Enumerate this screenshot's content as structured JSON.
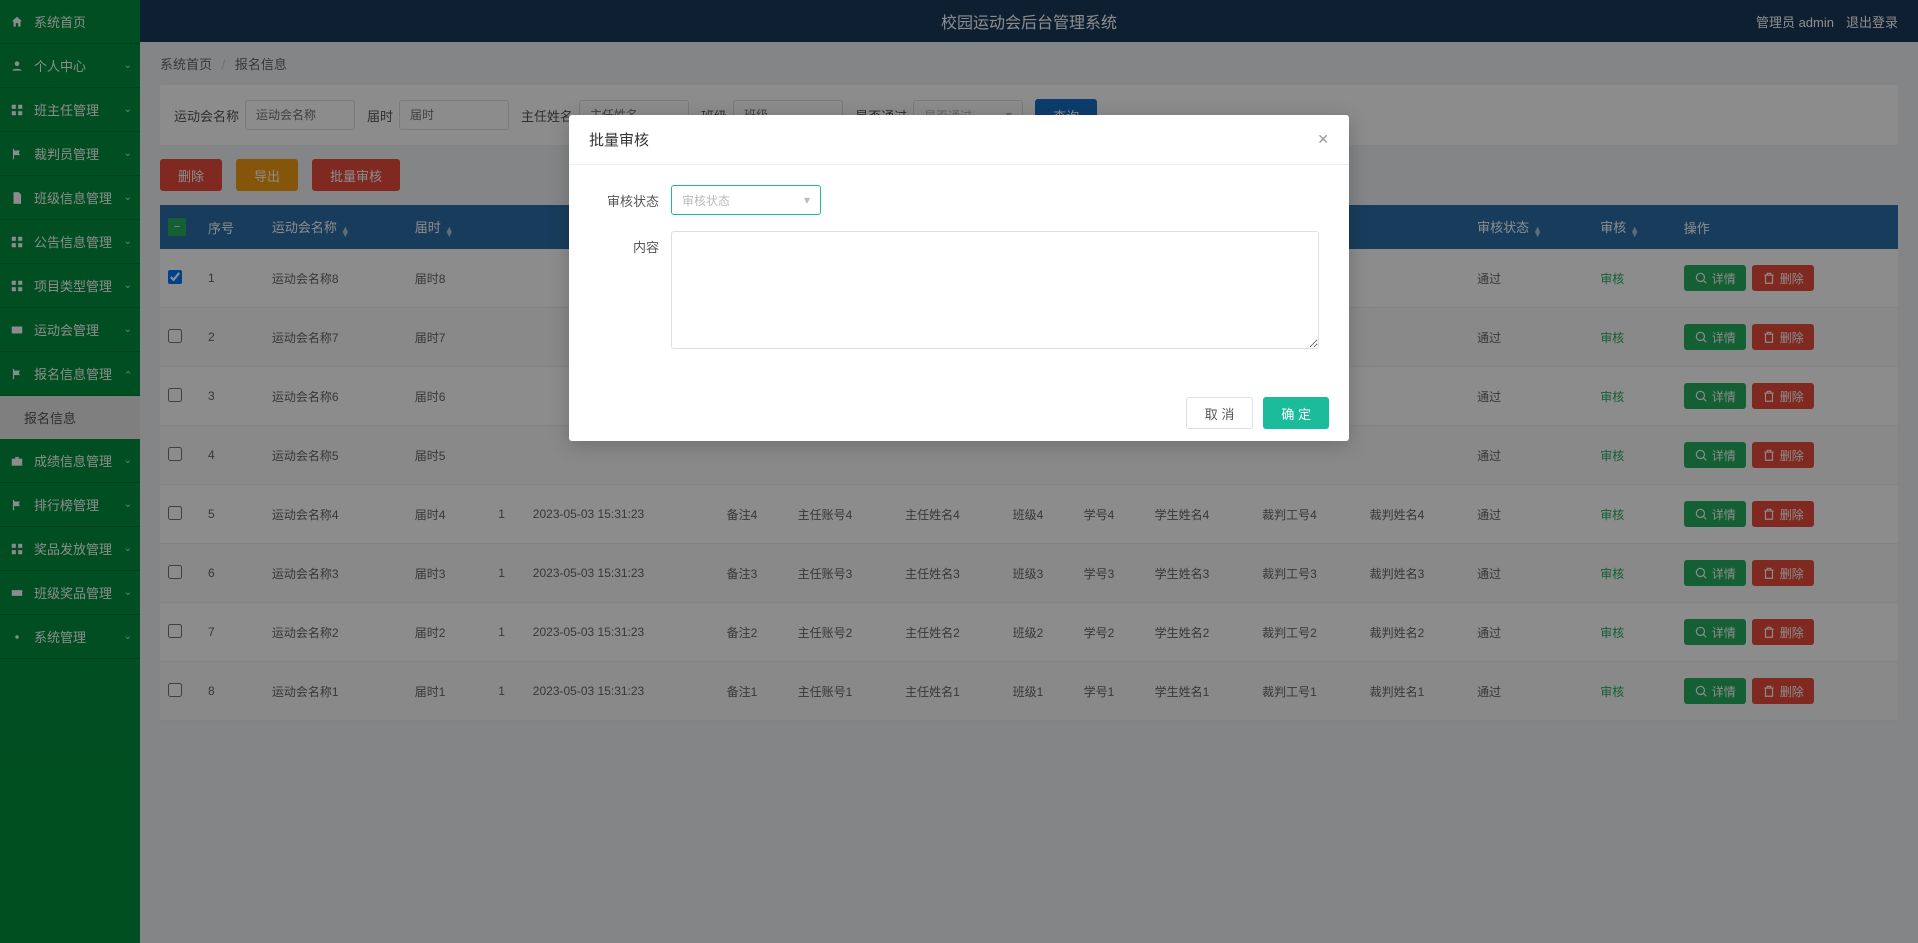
{
  "header": {
    "title": "校园运动会后台管理系统",
    "admin_label": "管理员 admin",
    "logout": "退出登录"
  },
  "sidebar": {
    "items": [
      {
        "label": "系统首页",
        "icon": "home"
      },
      {
        "label": "个人中心",
        "icon": "user"
      },
      {
        "label": "班主任管理",
        "icon": "grid"
      },
      {
        "label": "裁判员管理",
        "icon": "flag"
      },
      {
        "label": "班级信息管理",
        "icon": "file"
      },
      {
        "label": "公告信息管理",
        "icon": "grid"
      },
      {
        "label": "项目类型管理",
        "icon": "grid"
      },
      {
        "label": "运动会管理",
        "icon": "card"
      },
      {
        "label": "报名信息管理",
        "icon": "flag",
        "expanded": true,
        "sub": "报名信息"
      },
      {
        "label": "成绩信息管理",
        "icon": "case"
      },
      {
        "label": "排行榜管理",
        "icon": "flag"
      },
      {
        "label": "奖品发放管理",
        "icon": "grid"
      },
      {
        "label": "班级奖品管理",
        "icon": "ticket"
      },
      {
        "label": "系统管理",
        "icon": "gear"
      }
    ]
  },
  "breadcrumb": {
    "home": "系统首页",
    "current": "报名信息"
  },
  "filters": {
    "name_label": "运动会名称",
    "name_ph": "运动会名称",
    "time_label": "届时",
    "time_ph": "届时",
    "teacher_label": "主任姓名",
    "teacher_ph": "主任姓名",
    "class_label": "班级",
    "class_ph": "班级",
    "pass_label": "是否通过",
    "pass_ph": "是否通过",
    "query_btn": "查询"
  },
  "actions": {
    "delete": "删除",
    "export": "导出",
    "batch": "批量审核"
  },
  "table": {
    "headers": [
      "",
      "序号",
      "运动会名称",
      "届时",
      "",
      "",
      "",
      "",
      "",
      "",
      "",
      "",
      "",
      "",
      "审核状态",
      "审核",
      "操作"
    ],
    "rows": [
      {
        "checked": true,
        "idx": "1",
        "name": "运动会名称8",
        "time": "届时8",
        "status": "通过",
        "review": "审核"
      },
      {
        "checked": false,
        "idx": "2",
        "name": "运动会名称7",
        "time": "届时7",
        "status": "通过",
        "review": "审核"
      },
      {
        "checked": false,
        "idx": "3",
        "name": "运动会名称6",
        "time": "届时6",
        "status": "通过",
        "review": "审核"
      },
      {
        "checked": false,
        "idx": "4",
        "name": "运动会名称5",
        "time": "届时5",
        "status": "通过",
        "review": "审核"
      },
      {
        "checked": false,
        "idx": "5",
        "name": "运动会名称4",
        "time": "届时4",
        "num": "1",
        "date": "2023-05-03 15:31:23",
        "remark": "备注4",
        "acct": "主任账号4",
        "tname": "主任姓名4",
        "class": "班级4",
        "sid": "学号4",
        "sname": "学生姓名4",
        "jid": "裁判工号4",
        "jname": "裁判姓名4",
        "status": "通过",
        "review": "审核"
      },
      {
        "checked": false,
        "idx": "6",
        "name": "运动会名称3",
        "time": "届时3",
        "num": "1",
        "date": "2023-05-03 15:31:23",
        "remark": "备注3",
        "acct": "主任账号3",
        "tname": "主任姓名3",
        "class": "班级3",
        "sid": "学号3",
        "sname": "学生姓名3",
        "jid": "裁判工号3",
        "jname": "裁判姓名3",
        "status": "通过",
        "review": "审核"
      },
      {
        "checked": false,
        "idx": "7",
        "name": "运动会名称2",
        "time": "届时2",
        "num": "1",
        "date": "2023-05-03 15:31:23",
        "remark": "备注2",
        "acct": "主任账号2",
        "tname": "主任姓名2",
        "class": "班级2",
        "sid": "学号2",
        "sname": "学生姓名2",
        "jid": "裁判工号2",
        "jname": "裁判姓名2",
        "status": "通过",
        "review": "审核"
      },
      {
        "checked": false,
        "idx": "8",
        "name": "运动会名称1",
        "time": "届时1",
        "num": "1",
        "date": "2023-05-03 15:31:23",
        "remark": "备注1",
        "acct": "主任账号1",
        "tname": "主任姓名1",
        "class": "班级1",
        "sid": "学号1",
        "sname": "学生姓名1",
        "jid": "裁判工号1",
        "jname": "裁判姓名1",
        "status": "通过",
        "review": "审核"
      }
    ],
    "detail_btn": "详情",
    "delete_btn": "删除"
  },
  "modal": {
    "title": "批量审核",
    "status_label": "审核状态",
    "status_ph": "审核状态",
    "content_label": "内容",
    "cancel": "取 消",
    "confirm": "确 定"
  }
}
